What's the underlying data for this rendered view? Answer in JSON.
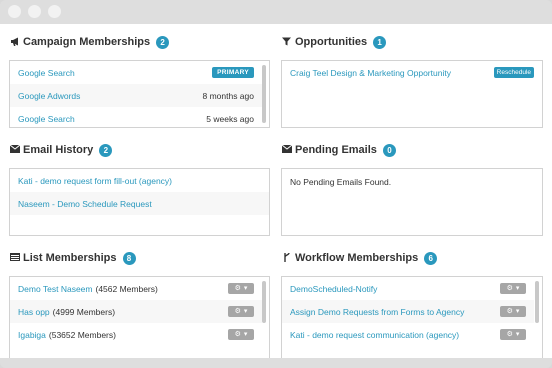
{
  "campaign": {
    "title": "Campaign Memberships",
    "count": "2",
    "icon": "megaphone-icon",
    "rows": [
      {
        "name": "Google Search",
        "pill": "PRIMARY"
      },
      {
        "name": "Google Adwords",
        "time": "8 months ago"
      },
      {
        "name": "Google Search",
        "time": "5 weeks ago"
      }
    ]
  },
  "opportunities": {
    "title": "Opportunities",
    "count": "1",
    "icon": "filter-icon",
    "rows": [
      {
        "name": "Craig Teel Design & Marketing Opportunity",
        "pill": "Reschedule"
      }
    ]
  },
  "email_history": {
    "title": "Email History",
    "count": "2",
    "icon": "envelope-icon",
    "rows": [
      {
        "name": "Kati - demo request form fill-out (agency)"
      },
      {
        "name": "Naseem - Demo Schedule Request"
      }
    ]
  },
  "pending_emails": {
    "title": "Pending Emails",
    "count": "0",
    "icon": "envelope-icon",
    "empty_text": "No Pending Emails Found."
  },
  "list_memberships": {
    "title": "List Memberships",
    "count": "8",
    "icon": "list-icon",
    "rows": [
      {
        "name": "Demo Test Naseem",
        "detail": "(4562 Members)"
      },
      {
        "name": "Has opp",
        "detail": "(4999 Members)"
      },
      {
        "name": "Igabiga",
        "detail": "(53652 Members)"
      }
    ]
  },
  "workflow_memberships": {
    "title": "Workflow Memberships",
    "count": "6",
    "icon": "branch-icon",
    "rows": [
      {
        "name": "DemoScheduled-Notify"
      },
      {
        "name": "Assign Demo Requests from Forms to Agency"
      },
      {
        "name": "Kati - demo request communication (agency)"
      }
    ]
  },
  "glyphs": {
    "gear": "⚙",
    "caret": "▾"
  },
  "colors": {
    "accent": "#2a98bd",
    "gear_button": "#a6a6a6"
  }
}
